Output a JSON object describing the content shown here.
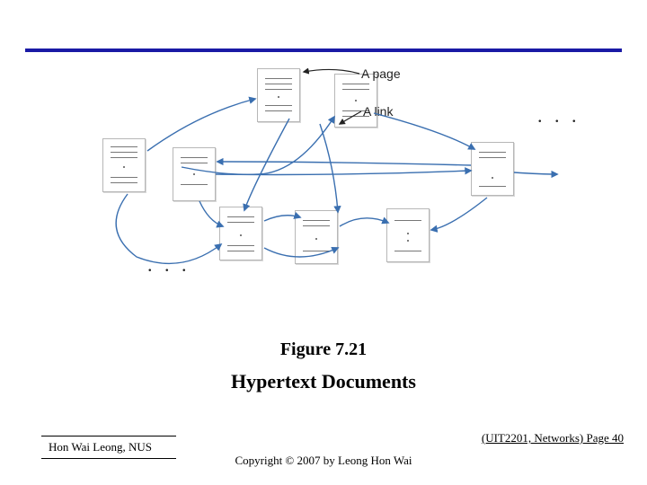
{
  "labels": {
    "a_page": "A page",
    "a_link": "A link",
    "ellipsis_right": ". . .",
    "ellipsis_bottom": ". . ."
  },
  "caption": {
    "figure_number": "Figure 7.21",
    "figure_title": "Hypertext Documents"
  },
  "footer": {
    "author": "Hon Wai Leong, NUS",
    "copyright": "Copyright © 2007 by Leong Hon Wai",
    "course_page": "(UIT2201, Networks) Page 40"
  },
  "diagram": {
    "pages_count": 8,
    "description": "Eight document pages connected by multiple curved hyperlinks; one page and one link are labeled."
  }
}
